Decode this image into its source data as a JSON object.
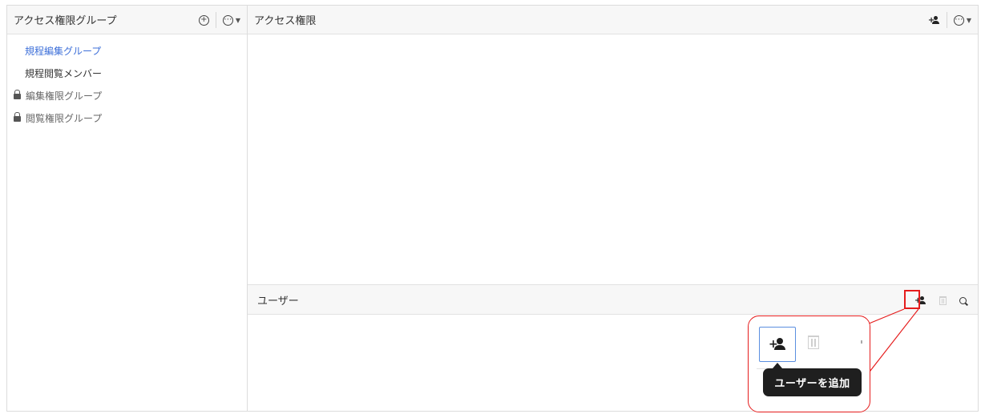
{
  "left_pane": {
    "title": "アクセス権限グループ",
    "add_icon": "circle-plus-icon",
    "more_icon": "circle-ellipsis-icon",
    "groups": [
      {
        "label": "規程編集グループ",
        "active": true,
        "locked": false
      },
      {
        "label": "規程閲覧メンバー",
        "active": false,
        "locked": false
      },
      {
        "label": "編集権限グループ",
        "active": false,
        "locked": true
      },
      {
        "label": "閲覧権限グループ",
        "active": false,
        "locked": true
      }
    ]
  },
  "access_pane": {
    "title": "アクセス権限",
    "add_icon": "add-user-icon",
    "more_icon": "circle-ellipsis-icon"
  },
  "users_pane": {
    "title": "ユーザー",
    "add_icon": "add-user-icon",
    "delete_icon": "trash-icon",
    "search_icon": "search-icon"
  },
  "callout": {
    "tooltip": "ユーザーを追加",
    "highlight_color": "#e51c1c",
    "focus_color": "#5b8fe0"
  },
  "colors": {
    "active_group": "#3d6fd9",
    "header_bg": "#f7f7f7"
  }
}
